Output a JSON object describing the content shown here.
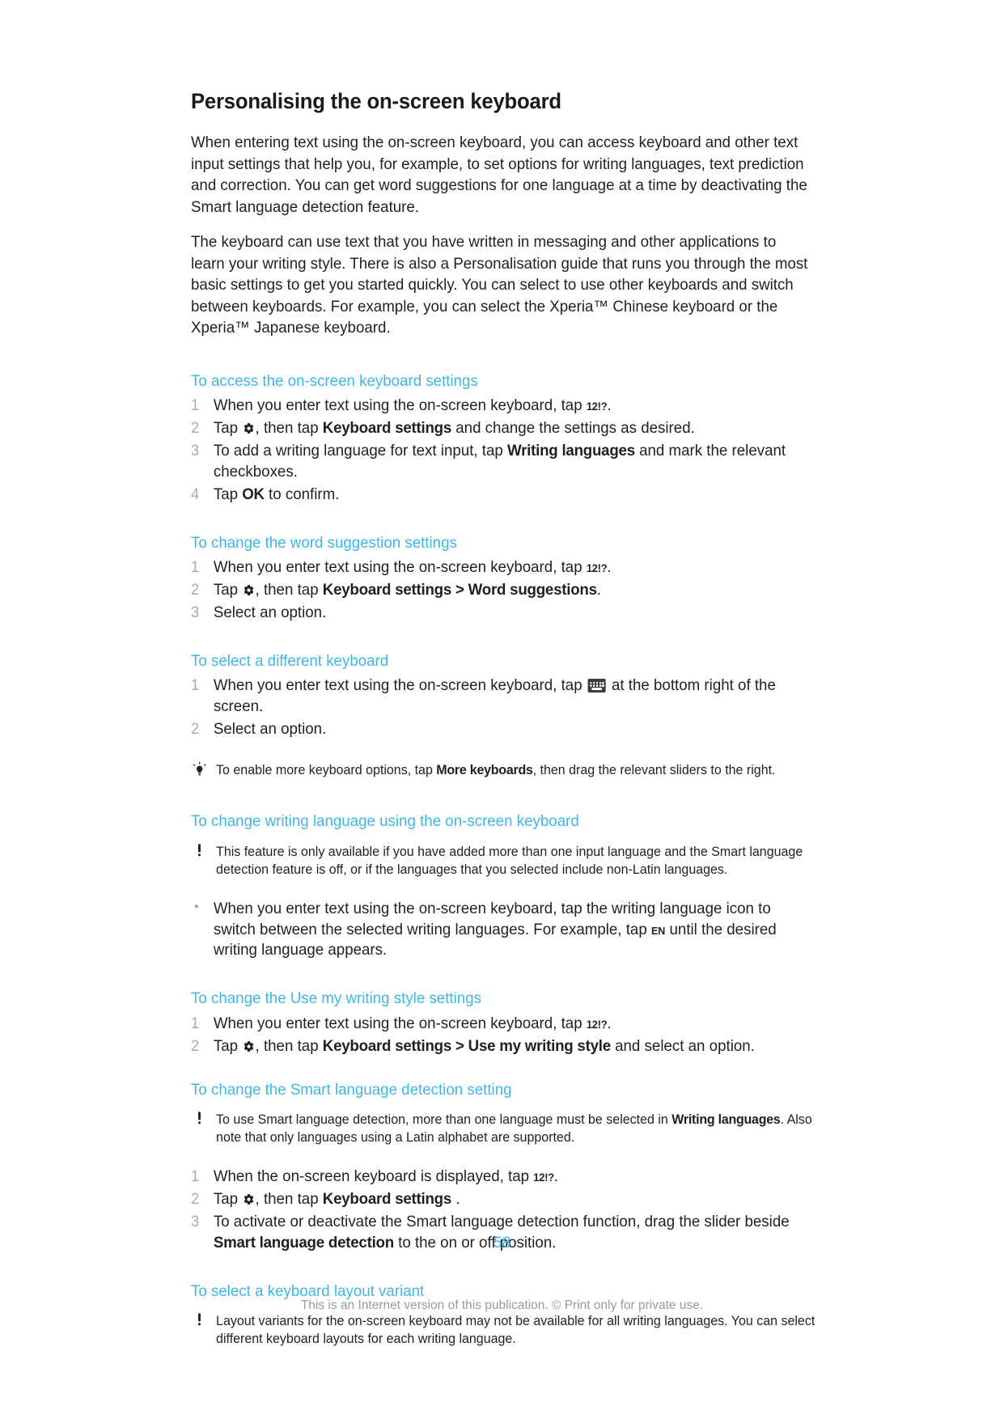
{
  "document": {
    "title": "Personalising the on-screen keyboard",
    "page_number": "58",
    "footer_note": "This is an Internet version of this publication. © Print only for private use."
  },
  "intro": {
    "paragraph_1": "When entering text using the on-screen keyboard, you can access keyboard and other text input settings that help you, for example, to set options for writing languages, text prediction and correction. You can get word suggestions for one language at a time by deactivating the Smart language detection feature.",
    "paragraph_2_a": "The keyboard can use text that you have written in messaging and other applications to learn your writing style. There is also a Personalisation guide that runs you through the most basic settings to get you started quickly. You can select to use other keyboards and switch between keyboards. For example, you can select the Xperia",
    "paragraph_2_tm1": "™",
    "paragraph_2_b": " Chinese keyboard or the Xperia",
    "paragraph_2_tm2": "™",
    "paragraph_2_c": " Japanese keyboard."
  },
  "icons": {
    "gear": "gear-icon",
    "keyboard": "keyboard-icon",
    "numeric_key": "12!?",
    "language_key": "EN",
    "tip": "lightbulb-icon",
    "note": "exclamation-icon"
  },
  "sections": [
    {
      "heading": "To access the on-screen keyboard settings",
      "steps": [
        {
          "pre": "When you enter text using the on-screen keyboard, tap ",
          "key": "12!?",
          "post": "."
        },
        {
          "pre": "Tap ",
          "gear": true,
          "mid": ", then tap ",
          "bold": "Keyboard settings",
          "post": " and change the settings as desired."
        },
        {
          "pre": "To add a writing language for text input, tap ",
          "bold": "Writing languages",
          "post": " and mark the relevant checkboxes."
        },
        {
          "pre": "Tap ",
          "bold": "OK",
          "post": " to confirm."
        }
      ]
    },
    {
      "heading": "To change the word suggestion settings",
      "steps": [
        {
          "pre": "When you enter text using the on-screen keyboard, tap ",
          "key": "12!?",
          "post": "."
        },
        {
          "pre": "Tap ",
          "gear": true,
          "mid": ", then tap ",
          "bold": "Keyboard settings",
          "sep": " > ",
          "bold2": "Word suggestions",
          "post": "."
        },
        {
          "pre": "Select an option."
        }
      ]
    },
    {
      "heading": "To select a different keyboard",
      "steps": [
        {
          "pre": "When you enter text using the on-screen keyboard, tap ",
          "kbd": true,
          "post": " at the bottom right of the screen."
        },
        {
          "pre": "Select an option."
        }
      ],
      "tip": {
        "pre": "To enable more keyboard options, tap ",
        "bold": "More keyboards",
        "post": ", then drag the relevant sliders to the right."
      }
    },
    {
      "heading": "To change writing language using the on-screen keyboard",
      "note": "This feature is only available if you have added more than one input language and the Smart language detection feature is off, or if the languages that you selected include non-Latin languages.",
      "bullet": {
        "pre": "When you enter text using the on-screen keyboard, tap the writing language icon to switch between the selected writing languages. For example, tap ",
        "key": "EN",
        "post": " until the desired writing language appears."
      }
    },
    {
      "heading": "To change the Use my writing style settings",
      "steps": [
        {
          "pre": "When you enter text using the on-screen keyboard, tap ",
          "key": "12!?",
          "post": "."
        },
        {
          "pre": "Tap ",
          "gear": true,
          "mid": ", then tap ",
          "bold": "Keyboard settings",
          "sep": " > ",
          "bold2": "Use my writing style",
          "post": " and select an option."
        }
      ]
    },
    {
      "heading": "To change the Smart language detection setting",
      "note_parts": {
        "pre": "To use Smart language detection, more than one language must be selected in ",
        "bold": "Writing languages",
        "post": ". Also note that only languages using a Latin alphabet are supported."
      },
      "steps": [
        {
          "pre": "When the on-screen keyboard is displayed, tap ",
          "key": "12!?",
          "post": "."
        },
        {
          "pre": "Tap ",
          "gear": true,
          "mid": ", then tap ",
          "bold": "Keyboard settings",
          "post": " ."
        },
        {
          "pre": "To activate or deactivate the Smart language detection function, drag the slider beside ",
          "bold": "Smart language detection",
          "post": " to the on or off position."
        }
      ]
    },
    {
      "heading": "To select a keyboard layout variant",
      "note": "Layout variants for the on-screen keyboard may not be available for all writing languages. You can select different keyboard layouts for each writing language."
    }
  ],
  "colors": {
    "heading_teal": "#3db7e4",
    "body_text": "#231f20",
    "step_number": "#a6a8ab",
    "footer_gray": "#9a9a9a"
  }
}
